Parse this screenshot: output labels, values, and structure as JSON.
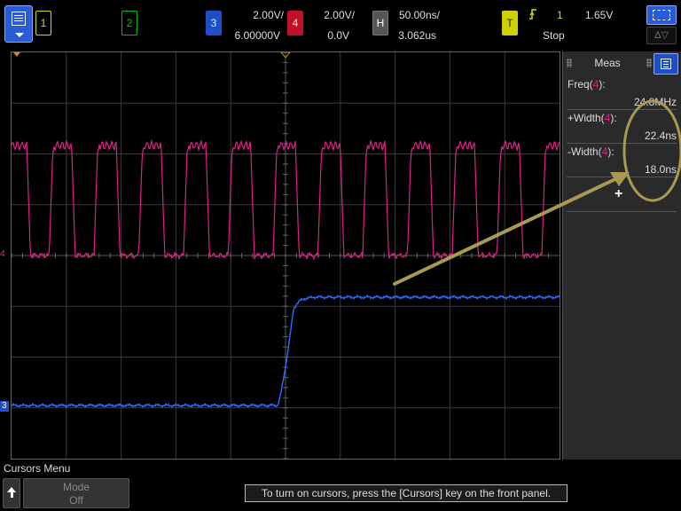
{
  "top": {
    "ch1": {
      "label": "1",
      "color": "#d8d800"
    },
    "ch2": {
      "label": "2",
      "color": "#00c000"
    },
    "ch3": {
      "label": "3",
      "scale": "2.00V/",
      "offset": "6.00000V",
      "color": "#2f6bff"
    },
    "ch4": {
      "label": "4",
      "scale": "2.00V/",
      "offset": "0.0V",
      "color": "#e0208a"
    },
    "horizontal": {
      "label": "H",
      "scale": "50.00ns/",
      "delay": "3.062us"
    },
    "trigger": {
      "label": "T",
      "edge_icon": "rising-edge-icon",
      "source": "1",
      "level": "1.65V",
      "state": "Stop"
    },
    "delta_label": "Δ▽"
  },
  "screen": {
    "ch4_marker": "4",
    "ch3_marker": "3"
  },
  "meas": {
    "title": "Meas",
    "items": [
      {
        "name": "Freq(",
        "src": "4",
        "close": "):",
        "value": "24.8MHz"
      },
      {
        "name": "+Width(",
        "src": "4",
        "close": "):",
        "value": "22.4ns"
      },
      {
        "name": "-Width(",
        "src": "4",
        "close": "):",
        "value": "18.0ns"
      }
    ],
    "add": "+"
  },
  "bottom": {
    "menu_title": "Cursors Menu",
    "mode_label": "Mode",
    "mode_value": "Off",
    "message": "To turn on cursors, press the [Cursors] key on the front panel."
  },
  "annotation": {
    "color": "#a89a50"
  }
}
